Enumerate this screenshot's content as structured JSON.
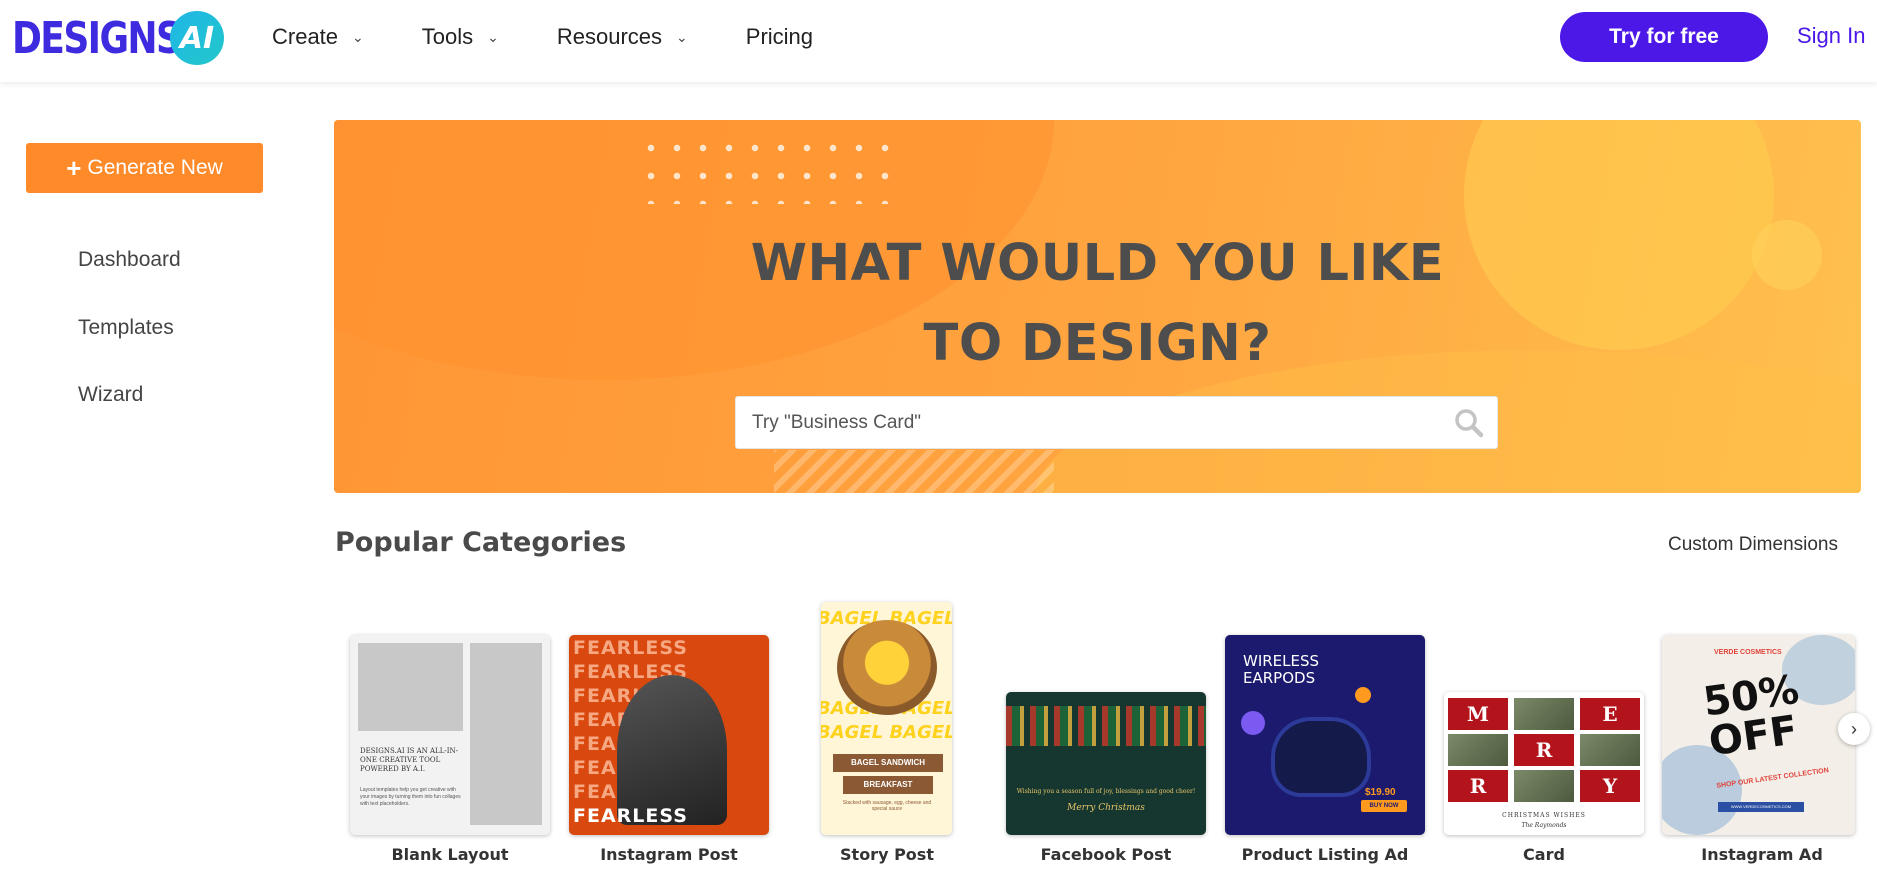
{
  "header": {
    "logo_text": "DESIGNS.",
    "logo_badge": "AI",
    "nav": [
      {
        "label": "Create",
        "has_dropdown": true
      },
      {
        "label": "Tools",
        "has_dropdown": true
      },
      {
        "label": "Resources",
        "has_dropdown": true
      },
      {
        "label": "Pricing",
        "has_dropdown": false
      }
    ],
    "try_button": "Try for free",
    "sign_in": "Sign In"
  },
  "sidebar": {
    "generate_button": "Generate New",
    "items": [
      {
        "label": "Dashboard"
      },
      {
        "label": "Templates"
      },
      {
        "label": "Wizard"
      }
    ]
  },
  "hero": {
    "title_line1": "WHAT WOULD YOU LIKE",
    "title_line2": "TO DESIGN?",
    "search_placeholder": "Try \"Business Card\""
  },
  "categories": {
    "title": "Popular Categories",
    "custom_dimensions": "Custom Dimensions",
    "items": [
      {
        "label": "Blank Layout"
      },
      {
        "label": "Instagram Post"
      },
      {
        "label": "Story Post"
      },
      {
        "label": "Facebook Post"
      },
      {
        "label": "Product Listing Ad"
      },
      {
        "label": "Card"
      },
      {
        "label": "Instagram Ad"
      }
    ]
  },
  "thumbs": {
    "blank_heading": "DESIGNS.AI IS AN ALL-IN-ONE CREATIVE TOOL POWERED BY A.I.",
    "blank_body": "Layout templates help you get creative with your images by turning them into fun collages with text placeholders.",
    "insta_word": "FEARLESS",
    "story_bg": "BAGEL BAGEL B",
    "story_r1": "BAGEL SANDWICH",
    "story_r2": "BREAKFAST",
    "story_note": "Stacked with sausage, egg, cheese and special sauce",
    "fb_msg": "Wishing you a season full of joy, blessings and good cheer!",
    "fb_sign": "Merry Christmas",
    "ad_heading_1": "WIRELESS",
    "ad_heading_2": "EARPODS",
    "ad_price": "$19.90",
    "ad_buy": "BUY NOW",
    "card_letters": [
      "M",
      "E",
      "R",
      "R",
      "Y"
    ],
    "card_foot": "CHRISTMAS WISHES",
    "card_sub": "The Raymonds",
    "ig2_brand": "VERDE COSMETICS",
    "ig2_big": "50% OFF",
    "ig2_small": "SHOP OUR LATEST COLLECTION",
    "ig2_url": "WWW.VERDECOSMETICS.COM"
  },
  "colors": {
    "brand": "#4b18e8",
    "accent_orange": "#ff8a2a",
    "logo_cyan": "#1fb6e8"
  },
  "icons": {
    "search": "search-icon",
    "next": "chevron-right-icon",
    "dropdown": "chevron-down-icon",
    "plus": "plus-icon"
  }
}
